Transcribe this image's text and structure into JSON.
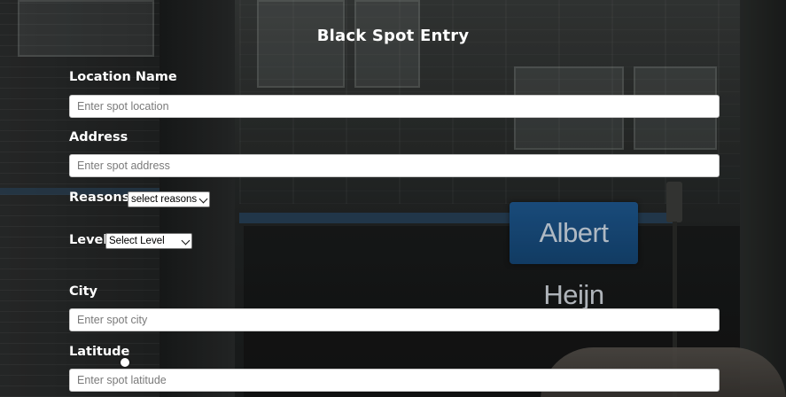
{
  "page": {
    "title": "Black Spot Entry",
    "sign_text": "Albert Heijn"
  },
  "fields": {
    "location": {
      "label": "Location Name",
      "placeholder": "Enter spot location",
      "value": ""
    },
    "address": {
      "label": "Address",
      "placeholder": "Enter spot address",
      "value": ""
    },
    "reasons": {
      "label": "Reasons",
      "selected": "select reasons"
    },
    "level": {
      "label": "Level",
      "selected": "Select Level"
    },
    "city": {
      "label": "City",
      "placeholder": "Enter spot city",
      "value": ""
    },
    "latitude": {
      "label": "Latitude",
      "placeholder": "Enter spot latitude",
      "value": ""
    }
  },
  "colors": {
    "text": "#ffffff",
    "input_bg": "#ffffff",
    "placeholder": "#7a7a7a",
    "sign_blue": "#1f5b95"
  },
  "icons": {
    "select_arrow": "chevron-down-icon",
    "cursor": "mouse-cursor-icon"
  }
}
